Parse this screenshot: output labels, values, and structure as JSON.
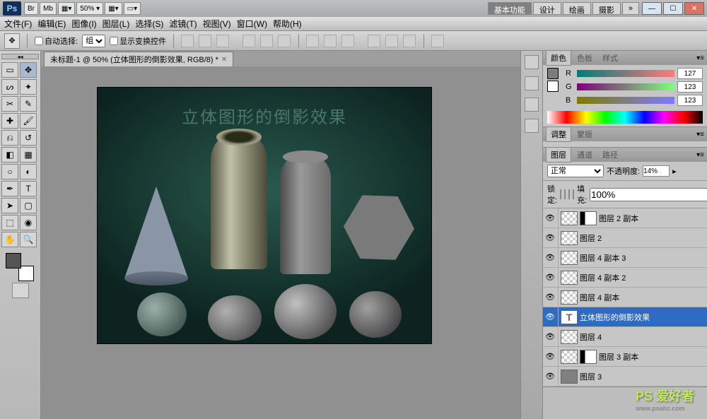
{
  "app": {
    "logo": "Ps"
  },
  "titlebar": {
    "buttons": [
      "Br",
      "Mb",
      "▦▾",
      "50%",
      "▦▾",
      "▭▾"
    ],
    "workspaces": [
      "基本功能",
      "设计",
      "绘画",
      "摄影",
      "»"
    ],
    "zoom": "50%"
  },
  "menus": [
    "文件(F)",
    "编辑(E)",
    "图像(I)",
    "图层(L)",
    "选择(S)",
    "滤镜(T)",
    "视图(V)",
    "窗口(W)",
    "帮助(H)"
  ],
  "options": {
    "auto_select": "自动选择:",
    "group": "组",
    "show_transform": "显示变换控件"
  },
  "document": {
    "tab_title": "未标题-1 @ 50% (立体图形的倒影效果, RGB/8) *",
    "artwork_title": "立体图形的倒影效果"
  },
  "panels": {
    "color": {
      "tabs": [
        "颜色",
        "色板",
        "样式"
      ],
      "channels": {
        "R": "127",
        "G": "123",
        "B": "123"
      }
    },
    "adjust": {
      "tabs": [
        "调整",
        "蒙版"
      ]
    },
    "layers": {
      "tabs": [
        "图层",
        "通道",
        "路径"
      ],
      "blend": "正常",
      "opacity_label": "不透明度:",
      "opacity": "14%",
      "lock_label": "锁定:",
      "fill_label": "填充:",
      "fill": "100%",
      "items": [
        {
          "name": "图层 2 副本",
          "mask": true
        },
        {
          "name": "图层 2"
        },
        {
          "name": "图层 4 副本 3"
        },
        {
          "name": "图层 4 副本 2"
        },
        {
          "name": "图层 4 副本"
        },
        {
          "name": "立体图形的倒影效果",
          "txt": true,
          "sel": true
        },
        {
          "name": "图层 4"
        },
        {
          "name": "图层 3 副本",
          "mask": true
        },
        {
          "name": "图层 3",
          "grey": true
        }
      ]
    }
  },
  "watermark": {
    "brand": "PS 爱好者",
    "url": "www.psahz.com"
  }
}
